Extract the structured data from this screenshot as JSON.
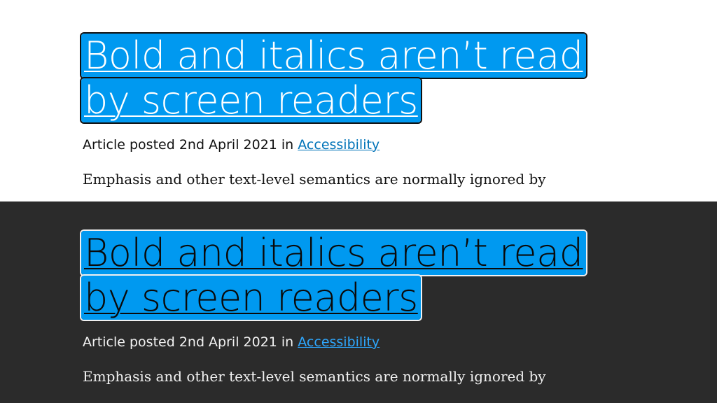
{
  "light": {
    "title_line1": "Bold and italics aren’t read",
    "title_line2": "by screen readers",
    "meta_prefix": "Article posted 2nd April 2021 in ",
    "category_link": "Accessibility",
    "excerpt": "Emphasis and other text-level semantics are normally ignored by"
  },
  "dark": {
    "title_line1": "Bold and italics aren’t read",
    "title_line2": "by screen readers",
    "meta_prefix": "Article posted 2nd April 2021 in ",
    "category_link": "Accessibility",
    "excerpt": "Emphasis and other text-level semantics are normally ignored by"
  },
  "colors": {
    "highlight": "#0099f0",
    "light_background": "#ffffff",
    "dark_background": "#2b2b2b",
    "light_link": "#0073b8",
    "dark_link": "#2ea8ff"
  }
}
